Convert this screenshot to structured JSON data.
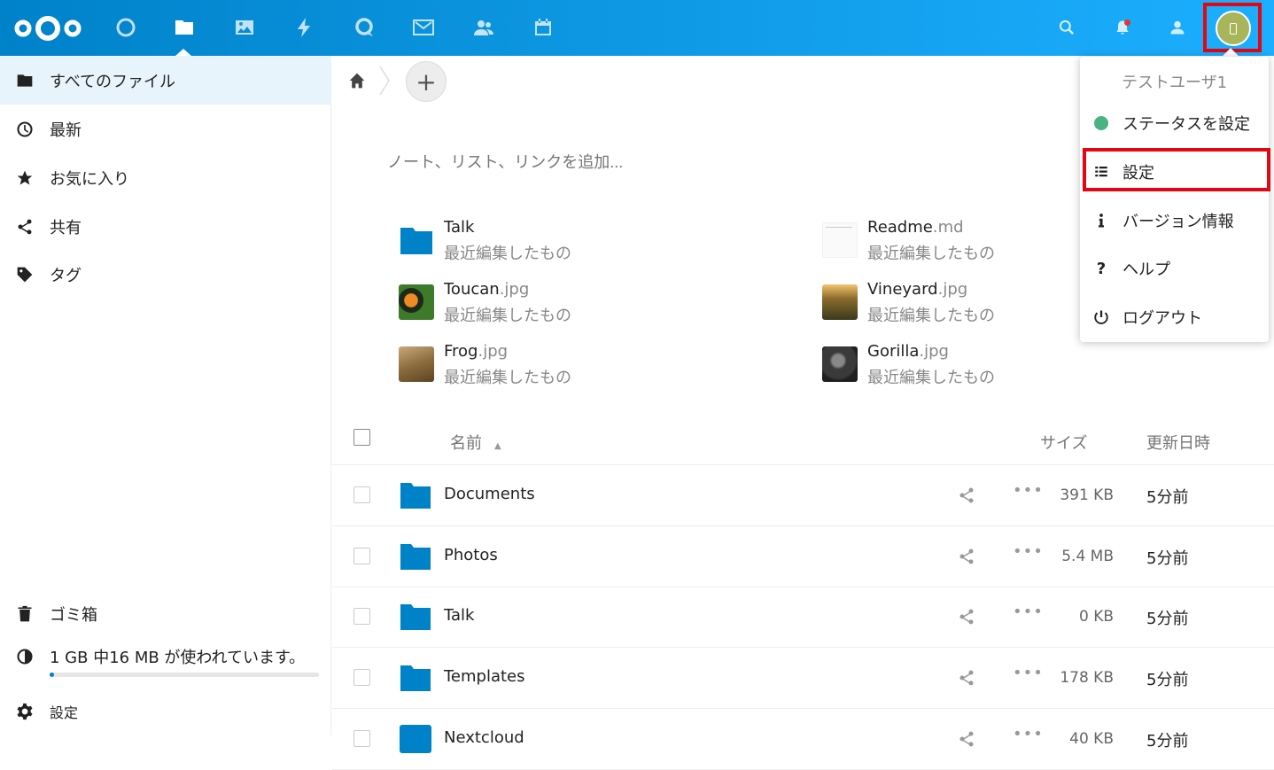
{
  "header": {
    "apps": [
      "dashboard",
      "files",
      "photos",
      "activity",
      "talk",
      "mail",
      "contacts",
      "calendar"
    ],
    "right_icons": [
      "search",
      "notifications",
      "contacts-menu",
      "user-avatar"
    ]
  },
  "sidebar": {
    "items": [
      {
        "label": "すべてのファイル",
        "icon": "folder-icon"
      },
      {
        "label": "最新",
        "icon": "clock-icon"
      },
      {
        "label": "お気に入り",
        "icon": "star-icon"
      },
      {
        "label": "共有",
        "icon": "share-icon"
      },
      {
        "label": "タグ",
        "icon": "tag-icon"
      }
    ],
    "trash_label": "ゴミ箱",
    "quota_label": "1 GB 中16 MB が使われています。",
    "quota_fraction": 0.016,
    "settings_label": "設定"
  },
  "main": {
    "note_placeholder": "ノート、リスト、リンクを追加...",
    "recent": [
      {
        "name": "Talk",
        "ext": "",
        "sub": "最近編集したもの",
        "kind": "folder"
      },
      {
        "name": "Readme",
        "ext": ".md",
        "sub": "最近編集したもの",
        "kind": "doc"
      },
      {
        "name": "Toucan",
        "ext": ".jpg",
        "sub": "最近編集したもの",
        "kind": "toucan"
      },
      {
        "name": "Vineyard",
        "ext": ".jpg",
        "sub": "最近編集したもの",
        "kind": "vineyard"
      },
      {
        "name": "Frog",
        "ext": ".jpg",
        "sub": "最近編集したもの",
        "kind": "frog"
      },
      {
        "name": "Gorilla",
        "ext": ".jpg",
        "sub": "最近編集したもの",
        "kind": "gorilla"
      }
    ],
    "columns": {
      "name": "名前",
      "size": "サイズ",
      "modified": "更新日時"
    },
    "files": [
      {
        "name": "Documents",
        "size": "391 KB",
        "modified": "5分前"
      },
      {
        "name": "Photos",
        "size": "5.4 MB",
        "modified": "5分前"
      },
      {
        "name": "Talk",
        "size": "0 KB",
        "modified": "5分前"
      },
      {
        "name": "Templates",
        "size": "178 KB",
        "modified": "5分前"
      },
      {
        "name": "Nextcloud",
        "size": "40 KB",
        "modified": "5分前"
      }
    ]
  },
  "user_menu": {
    "user_name": "テストユーザ1",
    "items": [
      {
        "label": "ステータスを設定",
        "icon": "status-dot"
      },
      {
        "label": "設定",
        "icon": "settings-list-icon"
      },
      {
        "label": "バージョン情報",
        "icon": "info-icon"
      },
      {
        "label": "ヘルプ",
        "icon": "help-icon"
      },
      {
        "label": "ログアウト",
        "icon": "power-icon"
      }
    ]
  },
  "colors": {
    "brand": "#0082c9",
    "highlight": "#e30613",
    "status_online": "#49b382"
  }
}
